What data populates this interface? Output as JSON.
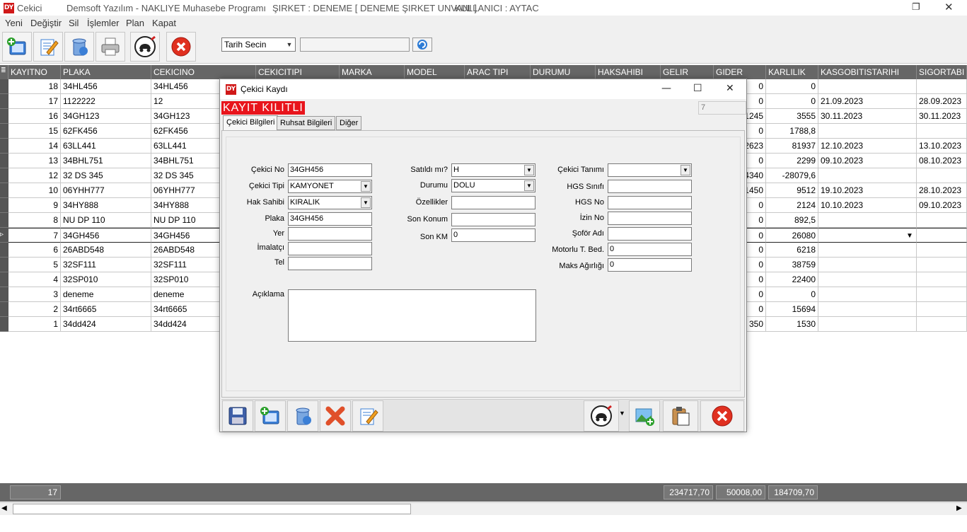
{
  "window": {
    "app_name": "Cekici",
    "program": "Demsoft Yazılım - NAKLIYE Muhasebe Programı",
    "company": "ŞIRKET : DENEME [ DENEME ŞIRKET UNVANI ]",
    "user": "KULLANICI : AYTAC"
  },
  "menu": [
    "Yeni",
    "Değiştir",
    "Sil",
    "İşlemler",
    "Plan",
    "Kapat"
  ],
  "toolbar": {
    "date_select": "Tarih Secin",
    "date_value": "",
    "icons": [
      "new-icon",
      "edit-icon",
      "delete-icon",
      "print-icon",
      "truck-service-icon",
      "close-icon"
    ]
  },
  "grid": {
    "columns": [
      "KAYITNO",
      "PLAKA",
      "CEKICINO",
      "CEKICITIPI",
      "MARKA",
      "MODEL",
      "ARAC TIPI",
      "DURUMU",
      "HAKSAHIBI",
      "GELIR",
      "GIDER",
      "KARLILIK",
      "KASGOBITISTARIHI",
      "SIGORTABI"
    ],
    "rows": [
      {
        "kayitno": "18",
        "plaka": "34HL456",
        "cekicino": "34HL456",
        "gider": "0",
        "karlilik": "0",
        "kasgo": "",
        "sigorta": ""
      },
      {
        "kayitno": "17",
        "plaka": "1122222",
        "cekicino": "12",
        "gider": "0",
        "karlilik": "0",
        "kasgo": "21.09.2023",
        "sigorta": "28.09.2023"
      },
      {
        "kayitno": "16",
        "plaka": "34GH123",
        "cekicino": "34GH123",
        "gider": "1245",
        "karlilik": "3555",
        "kasgo": "30.11.2023",
        "sigorta": "30.11.2023"
      },
      {
        "kayitno": "15",
        "plaka": "62FK456",
        "cekicino": "62FK456",
        "gider": "0",
        "karlilik": "1788,8",
        "kasgo": "",
        "sigorta": ""
      },
      {
        "kayitno": "14",
        "plaka": "63LL441",
        "cekicino": "63LL441",
        "gider": "2623",
        "karlilik": "81937",
        "kasgo": "12.10.2023",
        "sigorta": "13.10.2023"
      },
      {
        "kayitno": "13",
        "plaka": "34BHL751",
        "cekicino": "34BHL751",
        "gider": "0",
        "karlilik": "2299",
        "kasgo": "09.10.2023",
        "sigorta": "08.10.2023"
      },
      {
        "kayitno": "12",
        "plaka": "32 DS 345",
        "cekicino": "32 DS 345",
        "gider": "4340",
        "karlilik": "-28079,6",
        "kasgo": "",
        "sigorta": ""
      },
      {
        "kayitno": "10",
        "plaka": "06YHH777",
        "cekicino": "06YHH777",
        "gider": "1450",
        "karlilik": "9512",
        "kasgo": "19.10.2023",
        "sigorta": "28.10.2023"
      },
      {
        "kayitno": "9",
        "plaka": "34HY888",
        "cekicino": "34HY888",
        "gider": "0",
        "karlilik": "2124",
        "kasgo": "10.10.2023",
        "sigorta": "09.10.2023"
      },
      {
        "kayitno": "8",
        "plaka": "NU DP 110",
        "cekicino": "NU DP 110",
        "gider": "0",
        "karlilik": "892,5",
        "kasgo": "",
        "sigorta": ""
      },
      {
        "kayitno": "7",
        "plaka": "34GH456",
        "cekicino": "34GH456",
        "gider": "0",
        "karlilik": "26080",
        "kasgo": "",
        "sigorta": ""
      },
      {
        "kayitno": "6",
        "plaka": "26ABD548",
        "cekicino": "26ABD548",
        "gider": "0",
        "karlilik": "6218",
        "kasgo": "",
        "sigorta": ""
      },
      {
        "kayitno": "5",
        "plaka": "32SF111",
        "cekicino": "32SF111",
        "gider": "0",
        "karlilik": "38759",
        "kasgo": "",
        "sigorta": ""
      },
      {
        "kayitno": "4",
        "plaka": "32SP010",
        "cekicino": "32SP010",
        "gider": "0",
        "karlilik": "22400",
        "kasgo": "",
        "sigorta": ""
      },
      {
        "kayitno": "3",
        "plaka": "deneme",
        "cekicino": "deneme",
        "gider": "0",
        "karlilik": "0",
        "kasgo": "",
        "sigorta": ""
      },
      {
        "kayitno": "2",
        "plaka": "34rt6665",
        "cekicino": "34rt6665",
        "gider": "0",
        "karlilik": "15694",
        "kasgo": "",
        "sigorta": ""
      },
      {
        "kayitno": "1",
        "plaka": "34dd424",
        "cekicino": "34dd424",
        "gider": "350",
        "karlilik": "1530",
        "kasgo": "",
        "sigorta": ""
      }
    ],
    "current_row_index": 10
  },
  "footer": {
    "count": "17",
    "gelir_total": "234717,70",
    "gider_total": "50008,00",
    "karlilik_total": "184709,70"
  },
  "dialog": {
    "title": "Çekici Kaydı",
    "lock_label": "KAYIT KILITLI",
    "record_no": "7",
    "tabs": [
      "Çekici Bilgileri",
      "Ruhsat Bilgileri",
      "Diğer"
    ],
    "fields": {
      "cekici_no": {
        "label": "Çekici No",
        "value": "34GH456"
      },
      "cekici_tipi": {
        "label": "Çekici Tipi",
        "value": "KAMYONET"
      },
      "hak_sahibi": {
        "label": "Hak Sahibi",
        "value": "KIRALIK"
      },
      "plaka": {
        "label": "Plaka",
        "value": "34GH456"
      },
      "yer": {
        "label": "Yer",
        "value": ""
      },
      "imalatci": {
        "label": "İmalatçı",
        "value": ""
      },
      "tel": {
        "label": "Tel",
        "value": ""
      },
      "satildi_mi": {
        "label": "Satıldı mı?",
        "value": "H"
      },
      "durumu": {
        "label": "Durumu",
        "value": "DOLU"
      },
      "ozellikler": {
        "label": "Özellikler",
        "value": ""
      },
      "son_konum": {
        "label": "Son Konum",
        "value": ""
      },
      "son_km": {
        "label": "Son KM",
        "value": "0"
      },
      "cekici_tanimi": {
        "label": "Çekici Tanımı",
        "value": ""
      },
      "hgs_sinifi": {
        "label": "HGS Sınıfı",
        "value": ""
      },
      "hgs_no": {
        "label": "HGS No",
        "value": ""
      },
      "izin_no": {
        "label": "İzin No",
        "value": ""
      },
      "sofor_adi": {
        "label": "Şoför Adı",
        "value": ""
      },
      "motorlu_t_bed": {
        "label": "Motorlu T. Bed.",
        "value": "0"
      },
      "maks_agirligi": {
        "label": "Maks Ağırlığı",
        "value": "0"
      },
      "aciklama": {
        "label": "Açıklama",
        "value": ""
      }
    },
    "bottom_icons": [
      "save-icon",
      "new-icon",
      "delete-icon",
      "cancel-icon",
      "edit-icon",
      "truck-service-icon",
      "add-image-icon",
      "paste-icon",
      "close-icon"
    ]
  },
  "colors": {
    "header_bg": "#666666",
    "lock_bg": "#e8141c",
    "close_red": "#e03020"
  }
}
